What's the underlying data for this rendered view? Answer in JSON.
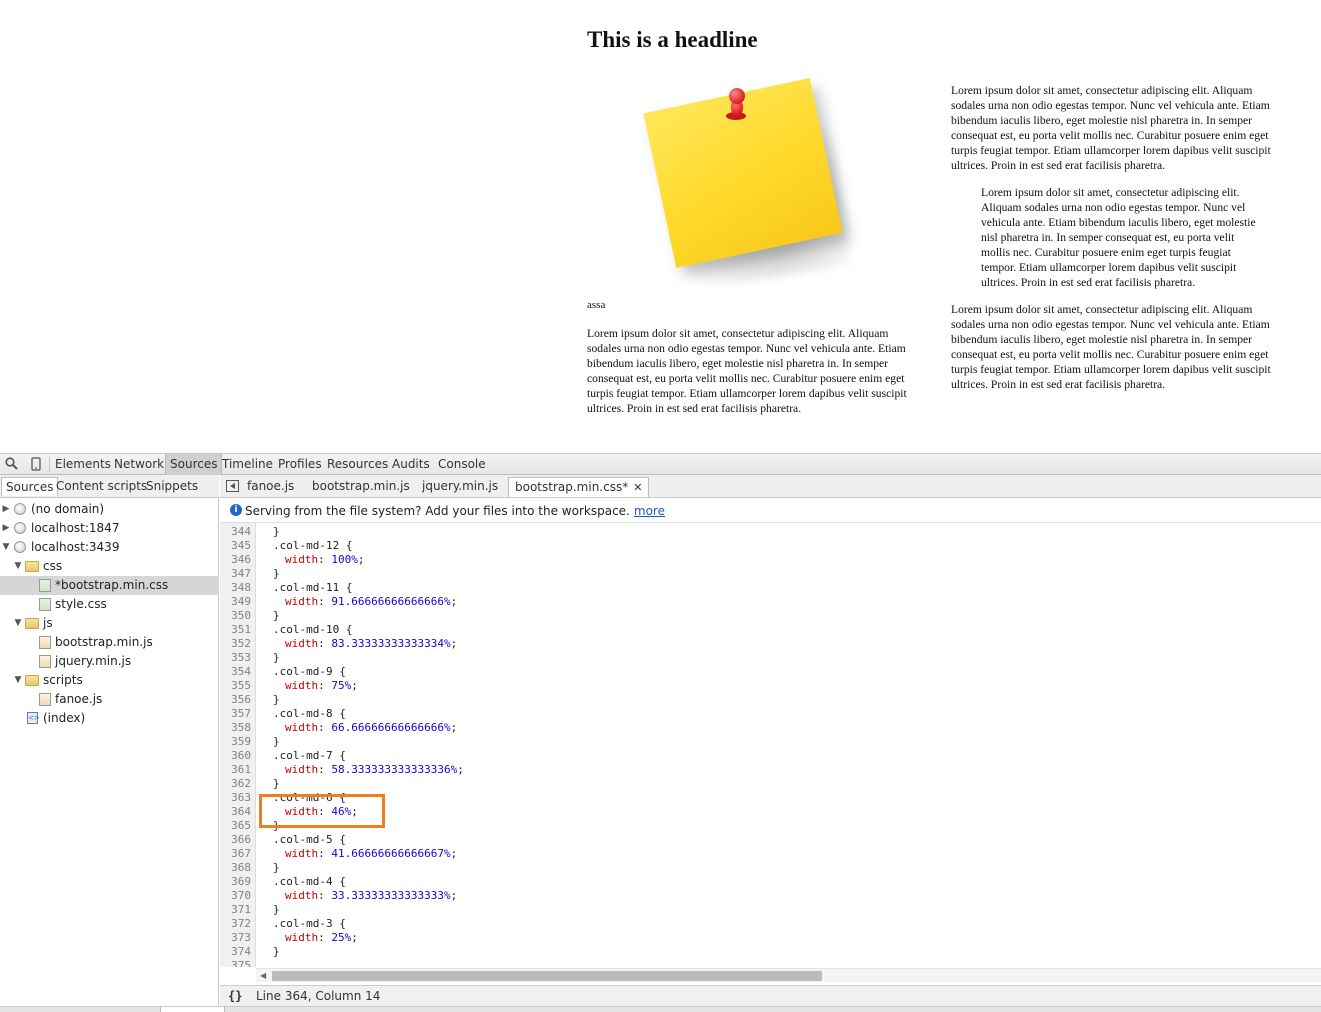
{
  "page": {
    "headline": "This is a headline",
    "caption": "assa",
    "paragraphs": {
      "left": "Lorem ipsum dolor sit amet, consectetur adipiscing elit. Aliquam sodales urna non odio egestas tempor. Nunc vel vehicula ante. Etiam bibendum iaculis libero, eget molestie nisl pharetra in. In semper consequat est, eu porta velit mollis nec. Curabitur posuere enim eget turpis feugiat tempor. Etiam ullamcorper lorem dapibus velit suscipit ultrices. Proin in est sed erat facilisis pharetra.",
      "right1": "Lorem ipsum dolor sit amet, consectetur adipiscing elit. Aliquam sodales urna non odio egestas tempor. Nunc vel vehicula ante. Etiam bibendum iaculis libero, eget molestie nisl pharetra in. In semper consequat est, eu porta velit mollis nec. Curabitur posuere enim eget turpis feugiat tempor. Etiam ullamcorper lorem dapibus velit suscipit ultrices. Proin in est sed erat facilisis pharetra.",
      "right2": "Lorem ipsum dolor sit amet, consectetur adipiscing elit. Aliquam sodales urna non odio egestas tempor. Nunc vel vehicula ante. Etiam bibendum iaculis libero, eget molestie nisl pharetra in. In semper consequat est, eu porta velit mollis nec. Curabitur posuere enim eget turpis feugiat tempor. Etiam ullamcorper lorem dapibus velit suscipit ultrices. Proin in est sed erat facilisis pharetra.",
      "right3": "Lorem ipsum dolor sit amet, consectetur adipiscing elit. Aliquam sodales urna non odio egestas tempor. Nunc vel vehicula ante. Etiam bibendum iaculis libero, eget molestie nisl pharetra in. In semper consequat est, eu porta velit mollis nec. Curabitur posuere enim eget turpis feugiat tempor. Etiam ullamcorper lorem dapibus velit suscipit ultrices. Proin in est sed erat facilisis pharetra."
    }
  },
  "devtools": {
    "toolbar": {
      "icons": [
        "search-icon",
        "device-mode-icon"
      ],
      "tabs": [
        "Elements",
        "Network",
        "Sources",
        "Timeline",
        "Profiles",
        "Resources",
        "Audits",
        "Console"
      ],
      "active_tab": "Sources"
    },
    "navigator": {
      "tabs": [
        "Sources",
        "Content scripts",
        "Snippets"
      ],
      "tree": [
        {
          "label": "(no domain)",
          "icon": "globe-icon",
          "expander": "▶"
        },
        {
          "label": "localhost:1847",
          "icon": "globe-icon",
          "expander": "▶"
        },
        {
          "label": "localhost:3439",
          "icon": "globe-icon",
          "expander": "▼"
        },
        {
          "label": "css",
          "icon": "folder-icon",
          "expander": "▼"
        },
        {
          "label": "*bootstrap.min.css",
          "icon": "css-file-icon",
          "selected": true
        },
        {
          "label": "style.css",
          "icon": "css-file-icon"
        },
        {
          "label": "js",
          "icon": "folder-icon",
          "expander": "▼"
        },
        {
          "label": "bootstrap.min.js",
          "icon": "js-file-icon"
        },
        {
          "label": "jquery.min.js",
          "icon": "js-file-icon"
        },
        {
          "label": "scripts",
          "icon": "folder-icon",
          "expander": "▼"
        },
        {
          "label": "fanoe.js",
          "icon": "js-file-icon"
        },
        {
          "label": "(index)",
          "icon": "html-file-icon"
        }
      ]
    },
    "editor": {
      "file_tabs": [
        "fanoe.js",
        "bootstrap.min.js",
        "jquery.min.js",
        "bootstrap.min.css*"
      ],
      "close_glyph": "✕",
      "info_icon": "i",
      "info_message": "Serving from the file system? Add your files into the workspace.",
      "info_link": "more",
      "code_lines": [
        {
          "n": "344",
          "text": "}"
        },
        {
          "n": "345",
          "text": ".col-md-12 {"
        },
        {
          "n": "346",
          "prop": "width",
          "value": "100%"
        },
        {
          "n": "347",
          "text": "}"
        },
        {
          "n": "348",
          "text": ".col-md-11 {"
        },
        {
          "n": "349",
          "prop": "width",
          "value": "91.66666666666666%"
        },
        {
          "n": "350",
          "text": "}"
        },
        {
          "n": "351",
          "text": ".col-md-10 {"
        },
        {
          "n": "352",
          "prop": "width",
          "value": "83.33333333333334%"
        },
        {
          "n": "353",
          "text": "}"
        },
        {
          "n": "354",
          "text": ".col-md-9 {"
        },
        {
          "n": "355",
          "prop": "width",
          "value": "75%"
        },
        {
          "n": "356",
          "text": "}"
        },
        {
          "n": "357",
          "text": ".col-md-8 {"
        },
        {
          "n": "358",
          "prop": "width",
          "value": "66.66666666666666%"
        },
        {
          "n": "359",
          "text": "}"
        },
        {
          "n": "360",
          "text": ".col-md-7 {"
        },
        {
          "n": "361",
          "prop": "width",
          "value": "58.333333333333336%"
        },
        {
          "n": "362",
          "text": "}"
        },
        {
          "n": "363",
          "text": ".col-md-6 {"
        },
        {
          "n": "364",
          "prop": "width",
          "value": "46%"
        },
        {
          "n": "365",
          "text": "}"
        },
        {
          "n": "366",
          "text": ".col-md-5 {"
        },
        {
          "n": "367",
          "prop": "width",
          "value": "41.66666666666667%"
        },
        {
          "n": "368",
          "text": "}"
        },
        {
          "n": "369",
          "text": ".col-md-4 {"
        },
        {
          "n": "370",
          "prop": "width",
          "value": "33.33333333333333%"
        },
        {
          "n": "371",
          "text": "}"
        },
        {
          "n": "372",
          "text": ".col-md-3 {"
        },
        {
          "n": "373",
          "prop": "width",
          "value": "25%"
        },
        {
          "n": "374",
          "text": "}"
        },
        {
          "n": "375",
          "text": ""
        }
      ],
      "status_braces": "{}",
      "cursor_position": "Line 364, Column 14"
    },
    "highlight_color": "#f07d1e"
  }
}
